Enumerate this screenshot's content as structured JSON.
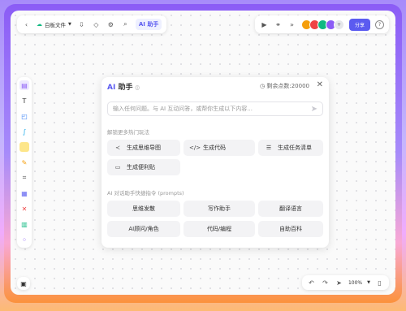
{
  "toolbar": {
    "file_name": "白板文件",
    "ai_label": "AI 助手",
    "share_label": "分享",
    "avatar_colors": [
      "#f59e0b",
      "#ef4444",
      "#10b981",
      "#8b5cf6"
    ],
    "avatar_more": "+"
  },
  "ai_panel": {
    "title_ai": "AI",
    "title_rest": "助手",
    "points_label": "剩余点数:20000",
    "input_placeholder": "输入任何问题。与 AI 互动问答，或帮你生成以下内容...",
    "section_features": "解锁更多热门玩法",
    "features": [
      {
        "icon": "mindmap-icon",
        "label": "生成思维导图"
      },
      {
        "icon": "code-icon",
        "label": "生成代码"
      },
      {
        "icon": "tasklist-icon",
        "label": "生成任务清单"
      },
      {
        "icon": "sticky-note-icon",
        "label": "生成便利贴"
      }
    ],
    "section_prompts": "AI 对话助手快捷指令 (prompts)",
    "prompts": [
      "思维发散",
      "写作助手",
      "翻译语言",
      "AI顾问/角色",
      "代码/编程",
      "自助百科"
    ]
  },
  "bottom_bar": {
    "zoom": "100%"
  }
}
